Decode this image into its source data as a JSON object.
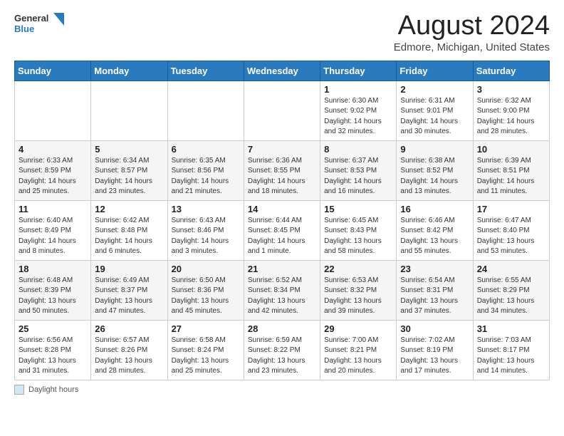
{
  "logo": {
    "line1": "General",
    "line2": "Blue"
  },
  "title": "August 2024",
  "subtitle": "Edmore, Michigan, United States",
  "days_of_week": [
    "Sunday",
    "Monday",
    "Tuesday",
    "Wednesday",
    "Thursday",
    "Friday",
    "Saturday"
  ],
  "footer": {
    "label": "Daylight hours"
  },
  "weeks": [
    [
      {
        "day": "",
        "info": ""
      },
      {
        "day": "",
        "info": ""
      },
      {
        "day": "",
        "info": ""
      },
      {
        "day": "",
        "info": ""
      },
      {
        "day": "1",
        "info": "Sunrise: 6:30 AM\nSunset: 9:02 PM\nDaylight: 14 hours\nand 32 minutes."
      },
      {
        "day": "2",
        "info": "Sunrise: 6:31 AM\nSunset: 9:01 PM\nDaylight: 14 hours\nand 30 minutes."
      },
      {
        "day": "3",
        "info": "Sunrise: 6:32 AM\nSunset: 9:00 PM\nDaylight: 14 hours\nand 28 minutes."
      }
    ],
    [
      {
        "day": "4",
        "info": "Sunrise: 6:33 AM\nSunset: 8:59 PM\nDaylight: 14 hours\nand 25 minutes."
      },
      {
        "day": "5",
        "info": "Sunrise: 6:34 AM\nSunset: 8:57 PM\nDaylight: 14 hours\nand 23 minutes."
      },
      {
        "day": "6",
        "info": "Sunrise: 6:35 AM\nSunset: 8:56 PM\nDaylight: 14 hours\nand 21 minutes."
      },
      {
        "day": "7",
        "info": "Sunrise: 6:36 AM\nSunset: 8:55 PM\nDaylight: 14 hours\nand 18 minutes."
      },
      {
        "day": "8",
        "info": "Sunrise: 6:37 AM\nSunset: 8:53 PM\nDaylight: 14 hours\nand 16 minutes."
      },
      {
        "day": "9",
        "info": "Sunrise: 6:38 AM\nSunset: 8:52 PM\nDaylight: 14 hours\nand 13 minutes."
      },
      {
        "day": "10",
        "info": "Sunrise: 6:39 AM\nSunset: 8:51 PM\nDaylight: 14 hours\nand 11 minutes."
      }
    ],
    [
      {
        "day": "11",
        "info": "Sunrise: 6:40 AM\nSunset: 8:49 PM\nDaylight: 14 hours\nand 8 minutes."
      },
      {
        "day": "12",
        "info": "Sunrise: 6:42 AM\nSunset: 8:48 PM\nDaylight: 14 hours\nand 6 minutes."
      },
      {
        "day": "13",
        "info": "Sunrise: 6:43 AM\nSunset: 8:46 PM\nDaylight: 14 hours\nand 3 minutes."
      },
      {
        "day": "14",
        "info": "Sunrise: 6:44 AM\nSunset: 8:45 PM\nDaylight: 14 hours\nand 1 minute."
      },
      {
        "day": "15",
        "info": "Sunrise: 6:45 AM\nSunset: 8:43 PM\nDaylight: 13 hours\nand 58 minutes."
      },
      {
        "day": "16",
        "info": "Sunrise: 6:46 AM\nSunset: 8:42 PM\nDaylight: 13 hours\nand 55 minutes."
      },
      {
        "day": "17",
        "info": "Sunrise: 6:47 AM\nSunset: 8:40 PM\nDaylight: 13 hours\nand 53 minutes."
      }
    ],
    [
      {
        "day": "18",
        "info": "Sunrise: 6:48 AM\nSunset: 8:39 PM\nDaylight: 13 hours\nand 50 minutes."
      },
      {
        "day": "19",
        "info": "Sunrise: 6:49 AM\nSunset: 8:37 PM\nDaylight: 13 hours\nand 47 minutes."
      },
      {
        "day": "20",
        "info": "Sunrise: 6:50 AM\nSunset: 8:36 PM\nDaylight: 13 hours\nand 45 minutes."
      },
      {
        "day": "21",
        "info": "Sunrise: 6:52 AM\nSunset: 8:34 PM\nDaylight: 13 hours\nand 42 minutes."
      },
      {
        "day": "22",
        "info": "Sunrise: 6:53 AM\nSunset: 8:32 PM\nDaylight: 13 hours\nand 39 minutes."
      },
      {
        "day": "23",
        "info": "Sunrise: 6:54 AM\nSunset: 8:31 PM\nDaylight: 13 hours\nand 37 minutes."
      },
      {
        "day": "24",
        "info": "Sunrise: 6:55 AM\nSunset: 8:29 PM\nDaylight: 13 hours\nand 34 minutes."
      }
    ],
    [
      {
        "day": "25",
        "info": "Sunrise: 6:56 AM\nSunset: 8:28 PM\nDaylight: 13 hours\nand 31 minutes."
      },
      {
        "day": "26",
        "info": "Sunrise: 6:57 AM\nSunset: 8:26 PM\nDaylight: 13 hours\nand 28 minutes."
      },
      {
        "day": "27",
        "info": "Sunrise: 6:58 AM\nSunset: 8:24 PM\nDaylight: 13 hours\nand 25 minutes."
      },
      {
        "day": "28",
        "info": "Sunrise: 6:59 AM\nSunset: 8:22 PM\nDaylight: 13 hours\nand 23 minutes."
      },
      {
        "day": "29",
        "info": "Sunrise: 7:00 AM\nSunset: 8:21 PM\nDaylight: 13 hours\nand 20 minutes."
      },
      {
        "day": "30",
        "info": "Sunrise: 7:02 AM\nSunset: 8:19 PM\nDaylight: 13 hours\nand 17 minutes."
      },
      {
        "day": "31",
        "info": "Sunrise: 7:03 AM\nSunset: 8:17 PM\nDaylight: 13 hours\nand 14 minutes."
      }
    ]
  ]
}
